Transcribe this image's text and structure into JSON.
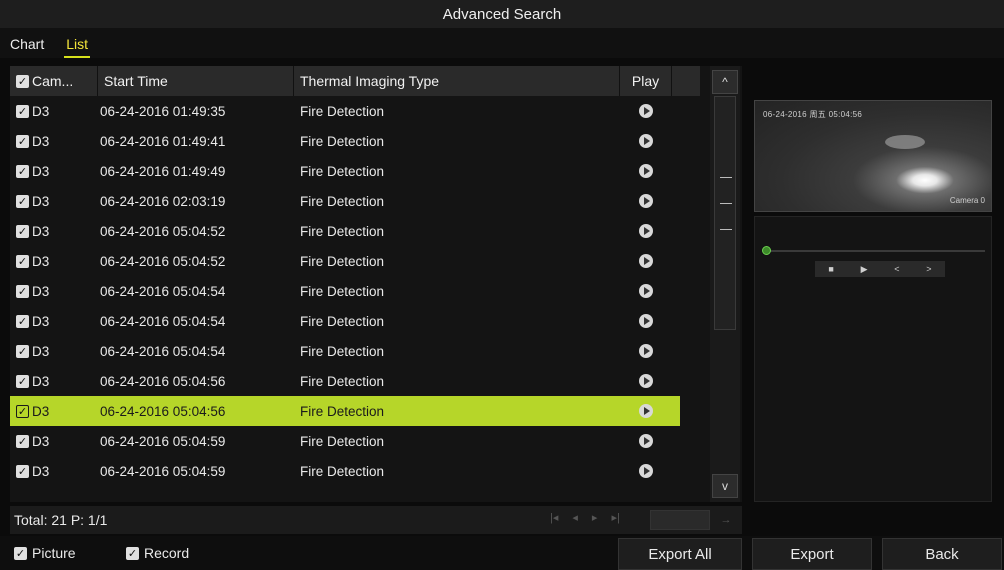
{
  "window": {
    "title": "Advanced Search"
  },
  "tabs": [
    {
      "label": "Chart",
      "active": false
    },
    {
      "label": "List",
      "active": true
    }
  ],
  "table": {
    "headers": {
      "camera": "Cam...",
      "start_time": "Start Time",
      "type": "Thermal Imaging Type",
      "play": "Play"
    },
    "rows": [
      {
        "camera": "D3",
        "start_time": "06-24-2016 01:49:35",
        "type": "Fire Detection",
        "selected": false
      },
      {
        "camera": "D3",
        "start_time": "06-24-2016 01:49:41",
        "type": "Fire Detection",
        "selected": false
      },
      {
        "camera": "D3",
        "start_time": "06-24-2016 01:49:49",
        "type": "Fire Detection",
        "selected": false
      },
      {
        "camera": "D3",
        "start_time": "06-24-2016 02:03:19",
        "type": "Fire Detection",
        "selected": false
      },
      {
        "camera": "D3",
        "start_time": "06-24-2016 05:04:52",
        "type": "Fire Detection",
        "selected": false
      },
      {
        "camera": "D3",
        "start_time": "06-24-2016 05:04:52",
        "type": "Fire Detection",
        "selected": false
      },
      {
        "camera": "D3",
        "start_time": "06-24-2016 05:04:54",
        "type": "Fire Detection",
        "selected": false
      },
      {
        "camera": "D3",
        "start_time": "06-24-2016 05:04:54",
        "type": "Fire Detection",
        "selected": false
      },
      {
        "camera": "D3",
        "start_time": "06-24-2016 05:04:54",
        "type": "Fire Detection",
        "selected": false
      },
      {
        "camera": "D3",
        "start_time": "06-24-2016 05:04:56",
        "type": "Fire Detection",
        "selected": false
      },
      {
        "camera": "D3",
        "start_time": "06-24-2016 05:04:56",
        "type": "Fire Detection",
        "selected": true
      },
      {
        "camera": "D3",
        "start_time": "06-24-2016 05:04:59",
        "type": "Fire Detection",
        "selected": false
      },
      {
        "camera": "D3",
        "start_time": "06-24-2016 05:04:59",
        "type": "Fire Detection",
        "selected": false
      }
    ]
  },
  "footer": {
    "total": "Total: 21  P: 1/1"
  },
  "preview": {
    "timestamp": "06-24-2016 周五 05:04:56",
    "camera_label": "Camera 0"
  },
  "options": {
    "picture": "Picture",
    "record": "Record"
  },
  "buttons": {
    "export_all": "Export All",
    "export": "Export",
    "back": "Back"
  },
  "colors": {
    "selected_row": "#b6d629",
    "active_tab": "#f4e53a",
    "background": "#0b0b0b"
  }
}
